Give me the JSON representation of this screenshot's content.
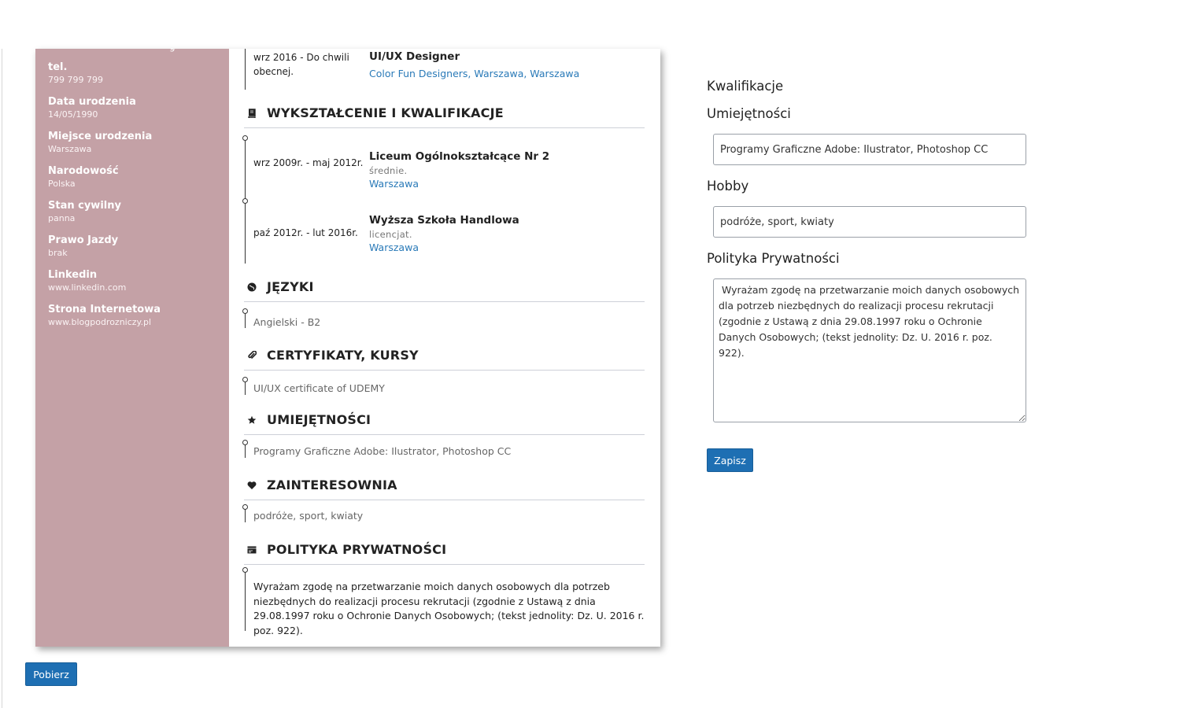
{
  "sidebar": {
    "cut_text": "g",
    "fields": [
      {
        "label": "tel.",
        "value": "799 799 799"
      },
      {
        "label": "Data urodzenia",
        "value": "14/05/1990"
      },
      {
        "label": "Miejsce urodzenia",
        "value": "Warszawa"
      },
      {
        "label": "Narodowość",
        "value": "Polska"
      },
      {
        "label": "Stan cywilny",
        "value": "panna"
      },
      {
        "label": "Prawo Jazdy",
        "value": "brak"
      },
      {
        "label": "Linkedin",
        "value": "www.linkedin.com"
      },
      {
        "label": "Strona Internetowa",
        "value": "www.blogpodrozniczy.pl"
      }
    ]
  },
  "experience": {
    "date": "wrz 2016 - Do chwili obecnej.",
    "title": "UI/UX Designer",
    "company": "Color Fun Designers, Warszawa, Warszawa"
  },
  "education": {
    "heading": "WYKSZTAŁCENIE I KWALIFIKACJE",
    "icon": "book-icon",
    "items": [
      {
        "date": "wrz 2009r. - maj 2012r.",
        "school": "Liceum Ogólnokształcące Nr 2",
        "level": "średnie.",
        "city": "Warszawa"
      },
      {
        "date": "paź 2012r. - lut 2016r.",
        "school": "Wyższa Szkoła Handlowa",
        "level": "licencjat.",
        "city": "Warszawa"
      }
    ]
  },
  "languages": {
    "heading": "JĘZYKI",
    "icon": "globe-icon",
    "text": "Angielski - B2"
  },
  "certificates": {
    "heading": "CERTYFIKATY, KURSY",
    "icon": "paperclip-icon",
    "text": "UI/UX certificate of UDEMY"
  },
  "skills": {
    "heading": "UMIEJĘTNOŚCI",
    "icon": "star-icon",
    "text": "Programy Graficzne Adobe: Ilustrator, Photoshop CC"
  },
  "interests": {
    "heading": "ZAINTERESOWNIA",
    "icon": "heart-icon",
    "text": "podróże, sport, kwiaty"
  },
  "privacy": {
    "heading": "POLITYKA PRYWATNOŚCI",
    "icon": "card-icon",
    "text": "Wyrażam zgodę na przetwarzanie moich danych osobowych dla potrzeb niezbędnych do realizacji procesu rekrutacji (zgodnie z Ustawą z dnia 29.08.1997 roku o Ochronie Danych Osobowych; (tekst jednolity: Dz. U. 2016 r. poz. 922)."
  },
  "form": {
    "section_title": "Kwalifikacje",
    "skills_label": "Umiejętności",
    "skills_value": "Programy Graficzne Adobe: Ilustrator, Photoshop CC",
    "hobby_label": "Hobby",
    "hobby_value": "podróże, sport, kwiaty",
    "privacy_label": "Polityka Prywatności",
    "privacy_value": " Wyrażam zgodę na przetwarzanie moich danych osobowych dla potrzeb niezbędnych do realizacji procesu rekrutacji (zgodnie z Ustawą z dnia 29.08.1997 roku o Ochronie Danych Osobowych; (tekst jednolity: Dz. U. 2016 r. poz. 922).",
    "save_label": "Zapisz"
  },
  "download_label": "Pobierz",
  "colors": {
    "sidebar": "#c4a1a6",
    "accent": "#1e6fb3",
    "link": "#2a7ab8"
  }
}
